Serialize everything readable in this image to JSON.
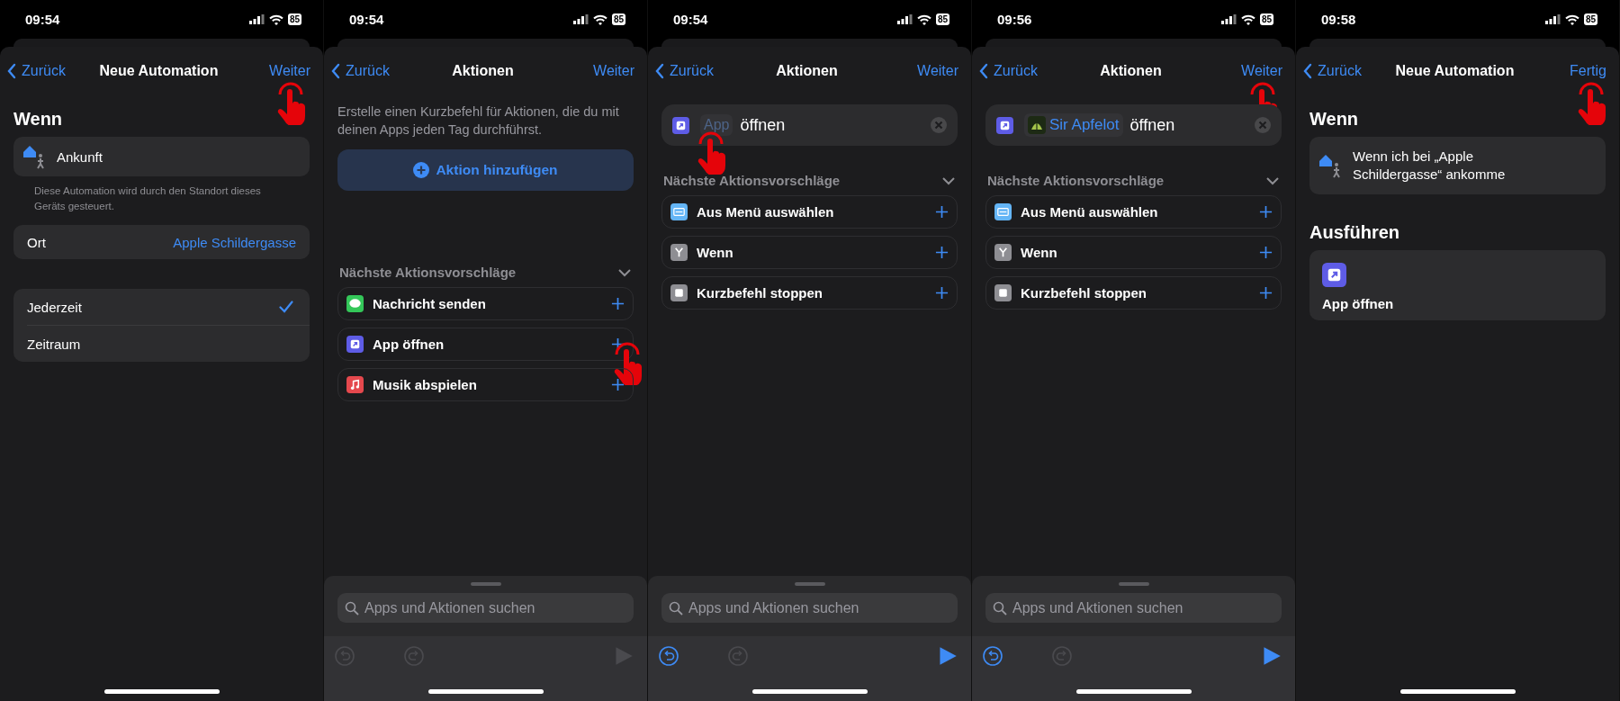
{
  "panels": [
    {
      "kind": "trigger",
      "status": {
        "time": "09:54",
        "battery": "85"
      },
      "nav": {
        "back": "Zurück",
        "title": "Neue Automation",
        "action": {
          "label": "Weiter",
          "tapped": true
        }
      },
      "heading": "Wenn",
      "trigger": "Ankunft",
      "note": "Diese Automation wird durch den Standort dieses Geräts gesteuert.",
      "location": {
        "label": "Ort",
        "value": "Apple Schildergasse"
      },
      "options": [
        {
          "label": "Jederzeit",
          "selected": true
        },
        {
          "label": "Zeitraum",
          "selected": false
        }
      ]
    },
    {
      "kind": "actions",
      "status": {
        "time": "09:54",
        "battery": "85"
      },
      "nav": {
        "back": "Zurück",
        "title": "Aktionen",
        "action": {
          "label": "Weiter",
          "tapped": false
        }
      },
      "intro": "Erstelle einen Kurzbefehl für Aktionen, die du mit deinen Apps jeden Tag durchführst.",
      "add_button": "Aktion hinzufügen",
      "suggestions_title": "Nächste Aktionsvorschläge",
      "suggestions": [
        {
          "label": "Nachricht senden",
          "kind": "message",
          "tapped": false
        },
        {
          "label": "App öffnen",
          "kind": "app",
          "tapped": true
        },
        {
          "label": "Musik abspielen",
          "kind": "music",
          "tapped": false
        }
      ],
      "search": {
        "placeholder": "Apps und Aktionen suchen"
      },
      "toolbar": {
        "undo_disabled": true,
        "redo_disabled": true,
        "run_disabled": true
      }
    },
    {
      "kind": "actions",
      "status": {
        "time": "09:54",
        "battery": "85"
      },
      "nav": {
        "back": "Zurück",
        "title": "Aktionen",
        "action": {
          "label": "Weiter",
          "tapped": false
        }
      },
      "action_step": {
        "app": {
          "label": "App",
          "kind": "placeholder",
          "tapped": true
        },
        "verb": "öffnen"
      },
      "suggestions_title": "Nächste Aktionsvorschläge",
      "suggestions": [
        {
          "label": "Aus Menü auswählen",
          "kind": "menu",
          "tapped": false
        },
        {
          "label": "Wenn",
          "kind": "if",
          "tapped": false
        },
        {
          "label": "Kurzbefehl stoppen",
          "kind": "stop",
          "tapped": false
        }
      ],
      "search": {
        "placeholder": "Apps und Aktionen suchen"
      },
      "toolbar": {
        "undo_disabled": false,
        "redo_disabled": true,
        "run_disabled": false
      }
    },
    {
      "kind": "actions",
      "status": {
        "time": "09:56",
        "battery": "85"
      },
      "nav": {
        "back": "Zurück",
        "title": "Aktionen",
        "action": {
          "label": "Weiter",
          "tapped": true
        }
      },
      "action_step": {
        "app": {
          "label": "Sir Apfelot",
          "kind": "app",
          "tapped": false
        },
        "verb": "öffnen"
      },
      "suggestions_title": "Nächste Aktionsvorschläge",
      "suggestions": [
        {
          "label": "Aus Menü auswählen",
          "kind": "menu",
          "tapped": false
        },
        {
          "label": "Wenn",
          "kind": "if",
          "tapped": false
        },
        {
          "label": "Kurzbefehl stoppen",
          "kind": "stop",
          "tapped": false
        }
      ],
      "search": {
        "placeholder": "Apps und Aktionen suchen"
      },
      "toolbar": {
        "undo_disabled": false,
        "redo_disabled": true,
        "run_disabled": false
      }
    },
    {
      "kind": "summary",
      "status": {
        "time": "09:58",
        "battery": "85"
      },
      "nav": {
        "back": "Zurück",
        "title": "Neue Automation",
        "action": {
          "label": "Fertig",
          "tapped": true
        }
      },
      "heading": "Wenn",
      "trigger": "Wenn ich bei „Apple Schildergasse“ ankomme",
      "run_heading": "Ausführen",
      "run_action": "App öffnen"
    }
  ]
}
